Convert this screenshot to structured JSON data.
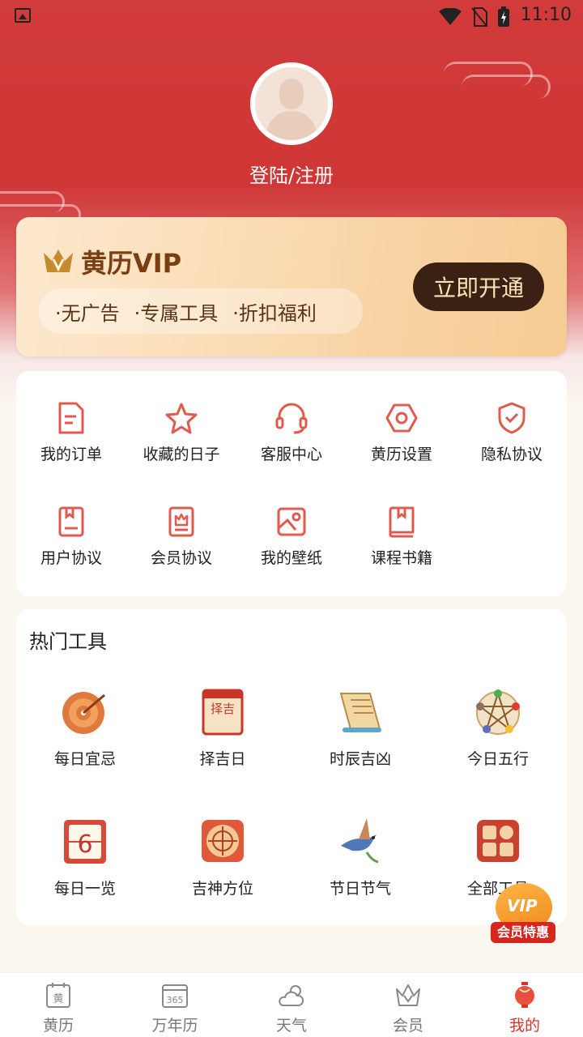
{
  "status_bar": {
    "time": "11:10"
  },
  "profile": {
    "login_label": "登陆/注册"
  },
  "vip": {
    "title": "黄历VIP",
    "perks": [
      "·无广告",
      "·专属工具",
      "·折扣福利"
    ],
    "button": "立即开通"
  },
  "menu": {
    "items": [
      {
        "label": "我的订单",
        "icon": "order-icon"
      },
      {
        "label": "收藏的日子",
        "icon": "star-icon"
      },
      {
        "label": "客服中心",
        "icon": "headset-icon"
      },
      {
        "label": "黄历设置",
        "icon": "settings-icon"
      },
      {
        "label": "隐私协议",
        "icon": "shield-icon"
      },
      {
        "label": "用户协议",
        "icon": "document-icon"
      },
      {
        "label": "会员协议",
        "icon": "crown-doc-icon"
      },
      {
        "label": "我的壁纸",
        "icon": "wallpaper-icon"
      },
      {
        "label": "课程书籍",
        "icon": "book-icon"
      }
    ]
  },
  "tools": {
    "title": "热门工具",
    "items": [
      {
        "label": "每日宜忌"
      },
      {
        "label": "择吉日",
        "icon_text": "择吉"
      },
      {
        "label": "时辰吉凶"
      },
      {
        "label": "今日五行"
      },
      {
        "label": "每日一览",
        "icon_text": "6"
      },
      {
        "label": "吉神方位"
      },
      {
        "label": "节日节气"
      },
      {
        "label": "全部工具"
      }
    ]
  },
  "badge": {
    "vip": "VIP",
    "text": "会员特惠"
  },
  "tabbar": {
    "items": [
      {
        "label": "黄历",
        "icon_text": "黄"
      },
      {
        "label": "万年历",
        "icon_text": "365"
      },
      {
        "label": "天气"
      },
      {
        "label": "会员"
      },
      {
        "label": "我的"
      }
    ],
    "active": 4
  },
  "colors": {
    "primary_red": "#d23b3b",
    "accent": "#e05a4e",
    "vip_gold": "#f9d6a8",
    "active_tab": "#d8362c"
  }
}
